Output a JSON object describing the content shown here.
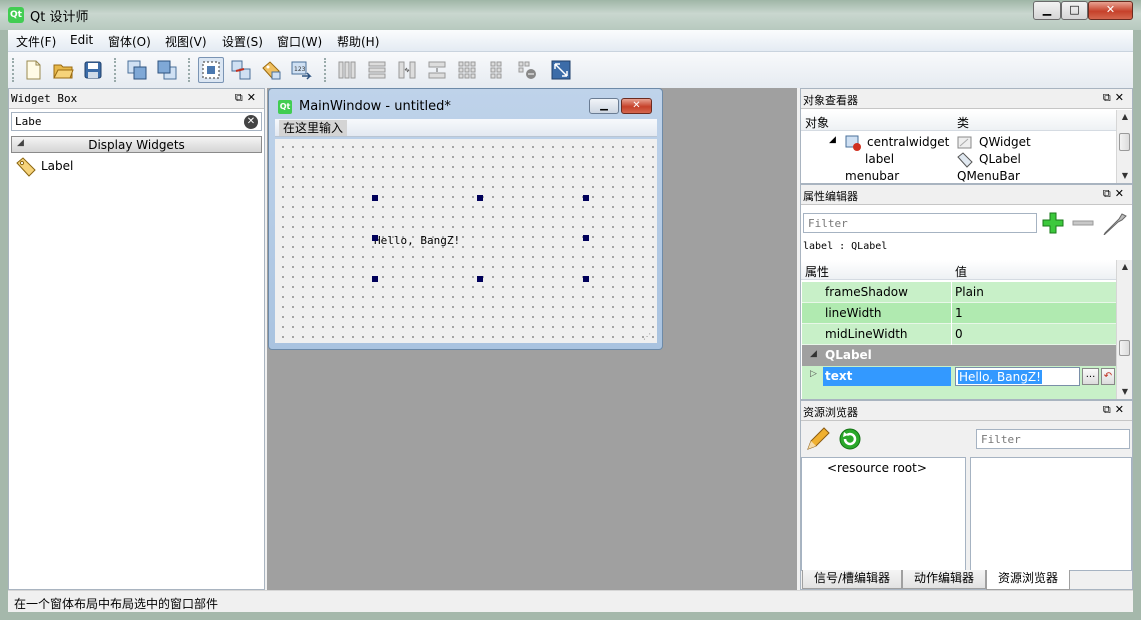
{
  "window": {
    "title": "Qt 设计师",
    "app_icon": "Qt"
  },
  "menubar": [
    {
      "label": "文件(F)"
    },
    {
      "label": "Edit"
    },
    {
      "label": "窗体(O)"
    },
    {
      "label": "视图(V)"
    },
    {
      "label": "设置(S)"
    },
    {
      "label": "窗口(W)"
    },
    {
      "label": "帮助(H)"
    }
  ],
  "toolbar": {
    "buttons": [
      "new-file-icon",
      "open-folder-icon",
      "save-icon",
      "send-to-back-icon",
      "bring-to-front-icon",
      "edit-widgets-icon",
      "edit-signals-slots-icon",
      "edit-buddies-icon",
      "edit-tab-order-icon",
      "layout-horizontal-icon",
      "layout-vertical-icon",
      "layout-horizontal-splitter-icon",
      "layout-vertical-splitter-icon",
      "layout-grid-icon",
      "layout-form-icon",
      "break-layout-icon",
      "adjust-size-icon"
    ],
    "active": "edit-widgets-icon"
  },
  "widget_box": {
    "title": "Widget Box",
    "search_value": "Labe",
    "category": "Display Widgets",
    "items": [
      {
        "label": "Label",
        "icon": "label-tag-icon"
      }
    ]
  },
  "form_window": {
    "title": "MainWindow - untitled*",
    "menu_placeholder": "在这里输入",
    "label_text": "Hello, BangZ!"
  },
  "object_inspector": {
    "title": "对象查看器",
    "columns": [
      "对象",
      "类"
    ],
    "rows": [
      {
        "object": "centralwidget",
        "class": "QWidget"
      },
      {
        "object": "label",
        "class": "QLabel"
      },
      {
        "object": "menubar",
        "class": "QMenuBar"
      }
    ]
  },
  "property_editor": {
    "title": "属性编辑器",
    "filter_placeholder": "Filter",
    "object_line": "label : QLabel",
    "columns": [
      "属性",
      "值"
    ],
    "rows": [
      {
        "name": "frameShadow",
        "value": "Plain"
      },
      {
        "name": "lineWidth",
        "value": "1"
      },
      {
        "name": "midLineWidth",
        "value": "0"
      }
    ],
    "group": "QLabel",
    "selected": {
      "name": "text",
      "value": "Hello, BangZ!",
      "dots": "...",
      "reset": "↶"
    }
  },
  "resource_browser": {
    "title": "资源浏览器",
    "filter_placeholder": "Filter",
    "tree_root": "<resource root>"
  },
  "bottom_tabs": [
    {
      "label": "信号/槽编辑器"
    },
    {
      "label": "动作编辑器"
    },
    {
      "label": "资源浏览器"
    }
  ],
  "statusbar": {
    "text": "在一个窗体布局中布局选中的窗口部件"
  },
  "colors": {
    "accent": "#3399ff",
    "property_row": "#c8f0c8",
    "group_row": "#a0a0a0",
    "central_bg": "#a0a0a0"
  }
}
